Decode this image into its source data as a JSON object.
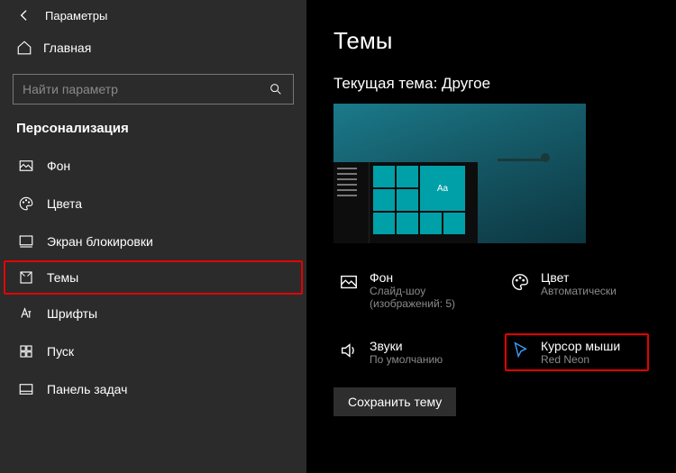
{
  "titlebar": {
    "title": "Параметры"
  },
  "home": {
    "label": "Главная"
  },
  "search": {
    "placeholder": "Найти параметр"
  },
  "section": {
    "title": "Персонализация"
  },
  "nav": {
    "items": [
      {
        "label": "Фон"
      },
      {
        "label": "Цвета"
      },
      {
        "label": "Экран блокировки"
      },
      {
        "label": "Темы"
      },
      {
        "label": "Шрифты"
      },
      {
        "label": "Пуск"
      },
      {
        "label": "Панель задач"
      }
    ]
  },
  "main": {
    "heading": "Темы",
    "current_theme_label": "Текущая тема: Другое",
    "preview_tile_text": "Aa",
    "save_button": "Сохранить тему"
  },
  "cards": {
    "background": {
      "title": "Фон",
      "sub": "Слайд-шоу (изображений: 5)"
    },
    "color": {
      "title": "Цвет",
      "sub": "Автоматически"
    },
    "sounds": {
      "title": "Звуки",
      "sub": "По умолчанию"
    },
    "cursor": {
      "title": "Курсор мыши",
      "sub": "Red Neon"
    }
  }
}
